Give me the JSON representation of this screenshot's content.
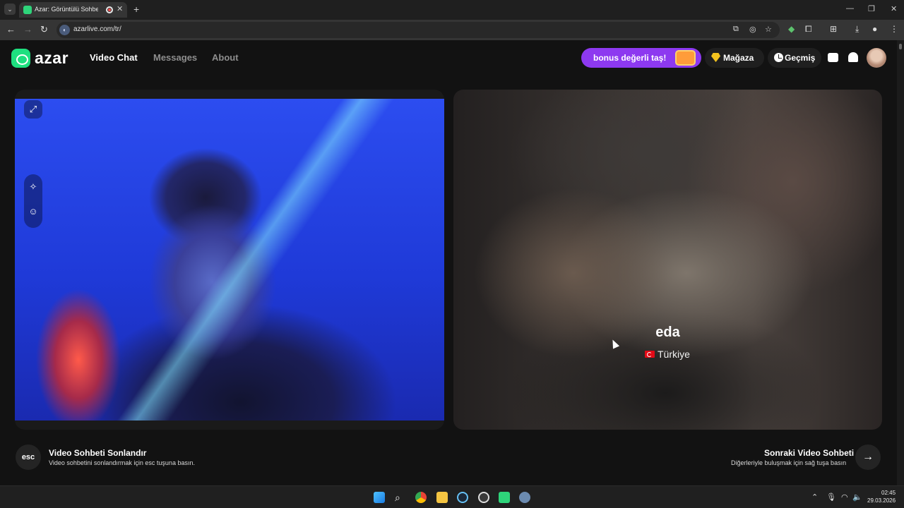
{
  "browser": {
    "tab_title": "Azar: Görüntülü Sohbet & V",
    "tab_close": "✕",
    "new_tab": "+",
    "url": "azarlive.com/tr/",
    "window": {
      "minimize": "—",
      "maximize": "❐",
      "close": "✕"
    }
  },
  "header": {
    "logo": "azar",
    "nav": [
      {
        "label": "Video Chat",
        "active": true
      },
      {
        "label": "Messages",
        "active": false
      },
      {
        "label": "About",
        "active": false
      }
    ],
    "bonus_label": "bonus değerli taş!",
    "store_label": "Mağaza",
    "history_label": "Geçmiş"
  },
  "remote": {
    "name": "eda",
    "country": "Türkiye"
  },
  "controls": {
    "esc_key": "esc",
    "end_title": "Video Sohbeti Sonlandır",
    "end_sub": "Video sohbetini sonlandırmak için esc tuşuna basın.",
    "next_title": "Sonraki Video Sohbeti",
    "next_sub": "Diğerleriyle buluşmak için sağ tuşa basın",
    "next_icon": "→"
  },
  "taskbar": {
    "time": "02:45",
    "date": "29.03.2026"
  },
  "colors": {
    "brand_green": "#1ee07f",
    "bonus_purple": "#8d39f0",
    "background": "#121212"
  }
}
